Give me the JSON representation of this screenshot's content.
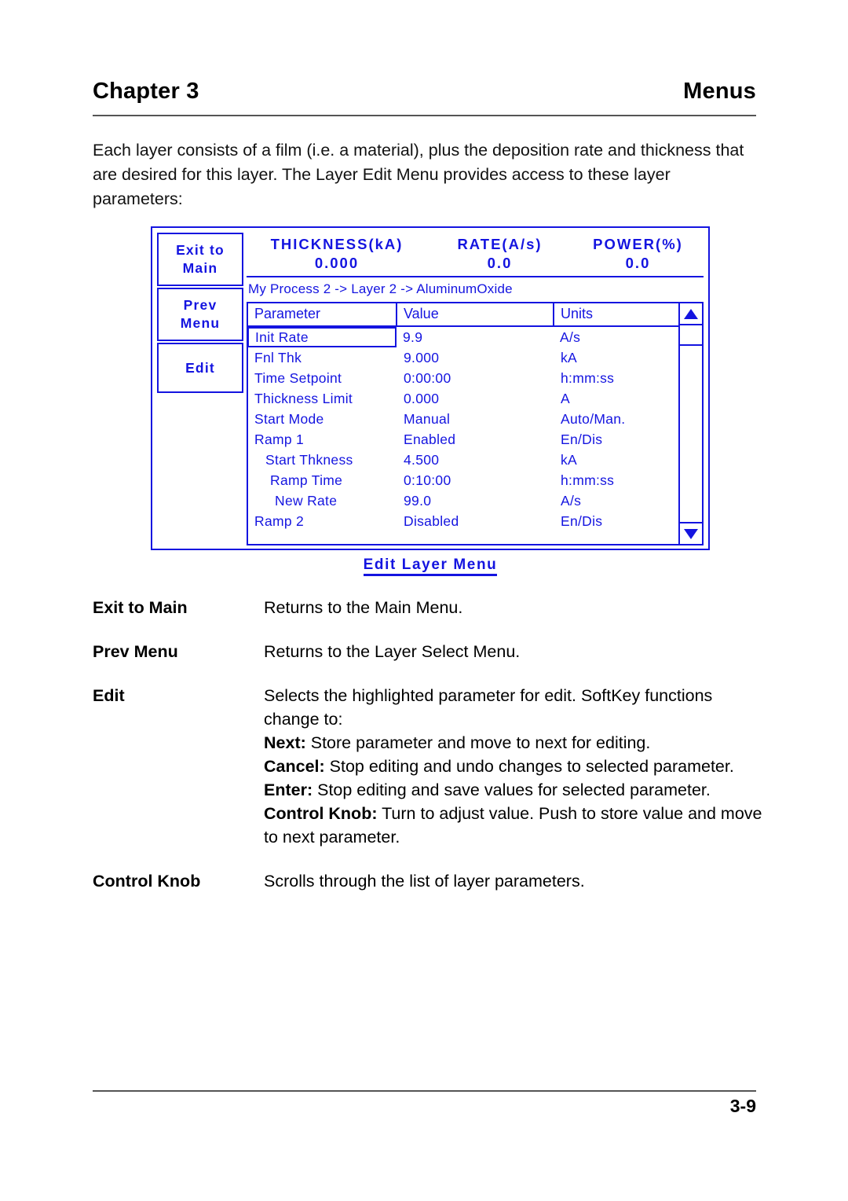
{
  "header": {
    "chapter": "Chapter 3",
    "section": "Menus"
  },
  "intro": "Each layer consists of a film (i.e. a material), plus the deposition rate and thickness that are desired for this layer.  The Layer Edit Menu provides access to these layer parameters:",
  "screen": {
    "softkeys": [
      {
        "line1": "Exit to",
        "line2": "Main"
      },
      {
        "line1": "Prev",
        "line2": "Menu"
      },
      {
        "line1": "Edit",
        "line2": ""
      }
    ],
    "status": {
      "labels": [
        "THICKNESS(kA)",
        "RATE(A/s)",
        "POWER(%)"
      ],
      "values": [
        "0.000",
        "0.0",
        "0.0"
      ]
    },
    "breadcrumb": "My Process 2 -> Layer 2 -> AluminumOxide",
    "table": {
      "columns": [
        "Parameter",
        "Value",
        "Units"
      ],
      "rows": [
        {
          "parameter": "Init Rate",
          "value": "9.9",
          "units": "A/s",
          "indent": 0,
          "selected": true
        },
        {
          "parameter": "Fnl Thk",
          "value": "9.000",
          "units": "kA",
          "indent": 0,
          "selected": false
        },
        {
          "parameter": "Time Setpoint",
          "value": "0:00:00",
          "units": "h:mm:ss",
          "indent": 0,
          "selected": false
        },
        {
          "parameter": "Thickness Limit",
          "value": "0.000",
          "units": "A",
          "indent": 0,
          "selected": false
        },
        {
          "parameter": "Start Mode",
          "value": "Manual",
          "units": "Auto/Man.",
          "indent": 0,
          "selected": false
        },
        {
          "parameter": "Ramp 1",
          "value": "Enabled",
          "units": "En/Dis",
          "indent": 0,
          "selected": false
        },
        {
          "parameter": "Start Thkness",
          "value": "4.500",
          "units": "kA",
          "indent": 1,
          "selected": false
        },
        {
          "parameter": "Ramp Time",
          "value": "0:10:00",
          "units": "h:mm:ss",
          "indent": 2,
          "selected": false
        },
        {
          "parameter": "New Rate",
          "value": "99.0",
          "units": "A/s",
          "indent": 3,
          "selected": false
        },
        {
          "parameter": "Ramp 2",
          "value": "Disabled",
          "units": "En/Dis",
          "indent": 0,
          "selected": false
        }
      ]
    },
    "scrollbar": {
      "up_icon": "triangle-up-icon",
      "down_icon": "triangle-down-icon"
    },
    "caption": "Edit Layer Menu",
    "accent_color": "#1414E0"
  },
  "definitions": [
    {
      "term": "Exit to Main",
      "description": "Returns to the Main Menu."
    },
    {
      "term": "Prev Menu",
      "description": "Returns to the Layer Select Menu."
    },
    {
      "term": "Edit",
      "description": "Selects the highlighted parameter for edit.  SoftKey functions change to:",
      "sublines": [
        {
          "label": "Next:",
          "text": " Store parameter and move to next for editing."
        },
        {
          "label": "Cancel:",
          "text": " Stop editing and undo changes to selected parameter."
        },
        {
          "label": "Enter:",
          "text": " Stop editing and save values for selected parameter."
        },
        {
          "label": "Control Knob:",
          "text": " Turn to adjust value.  Push to store value and move to next parameter."
        }
      ]
    },
    {
      "term": "Control Knob",
      "description": "Scrolls through the list of layer parameters."
    }
  ],
  "footer": {
    "page_number": "3-9"
  }
}
